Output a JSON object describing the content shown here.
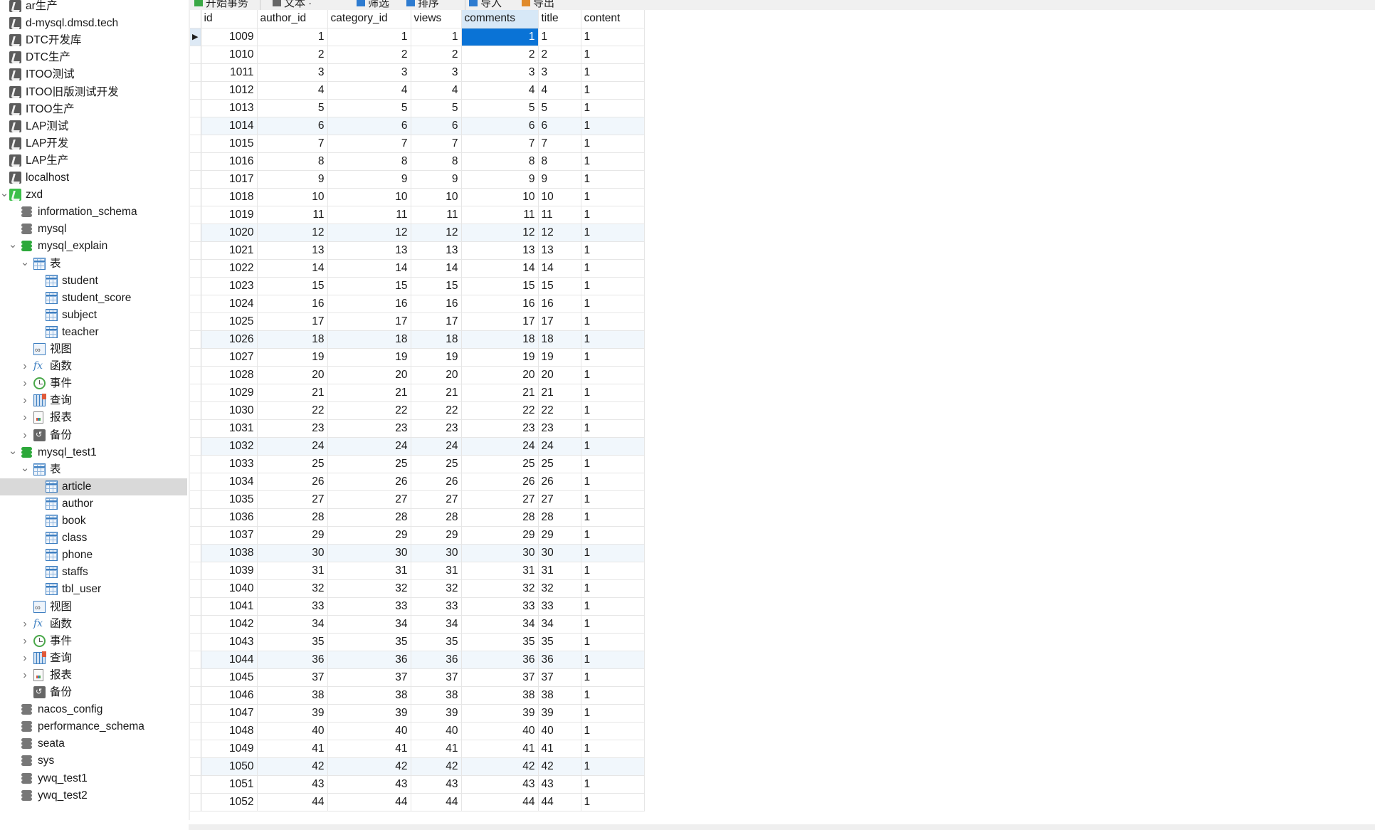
{
  "toolbar": {
    "buttons": [
      {
        "label": "开始事务",
        "icon": "begin-transaction-icon"
      },
      {
        "label": "文本 ·",
        "icon": "text-icon"
      },
      {
        "label": "筛选",
        "icon": "filter-icon"
      },
      {
        "label": "排序",
        "icon": "sort-icon"
      },
      {
        "label": "导入",
        "icon": "import-icon"
      },
      {
        "label": "导出",
        "icon": "export-icon"
      }
    ]
  },
  "sidebar": {
    "items": [
      {
        "label": "ar生产",
        "type": "connection",
        "level": 0
      },
      {
        "label": "d-mysql.dmsd.tech",
        "type": "connection",
        "level": 0
      },
      {
        "label": "DTC开发库",
        "type": "connection",
        "level": 0
      },
      {
        "label": "DTC生产",
        "type": "connection",
        "level": 0
      },
      {
        "label": "ITOO测试",
        "type": "connection",
        "level": 0
      },
      {
        "label": "ITOO旧版测试开发",
        "type": "connection",
        "level": 0
      },
      {
        "label": "ITOO生产",
        "type": "connection",
        "level": 0
      },
      {
        "label": "LAP测试",
        "type": "connection",
        "level": 0
      },
      {
        "label": "LAP开发",
        "type": "connection",
        "level": 0
      },
      {
        "label": "LAP生产",
        "type": "connection",
        "level": 0
      },
      {
        "label": "localhost",
        "type": "connection",
        "level": 0
      },
      {
        "label": "zxd",
        "type": "connection-open",
        "level": 0,
        "expanded": true
      },
      {
        "label": "information_schema",
        "type": "database",
        "level": 1
      },
      {
        "label": "mysql",
        "type": "database",
        "level": 1
      },
      {
        "label": "mysql_explain",
        "type": "database-open",
        "level": 1,
        "expanded": true
      },
      {
        "label": "表",
        "type": "tables",
        "level": 2,
        "expanded": true
      },
      {
        "label": "student",
        "type": "table",
        "level": 3
      },
      {
        "label": "student_score",
        "type": "table",
        "level": 3
      },
      {
        "label": "subject",
        "type": "table",
        "level": 3
      },
      {
        "label": "teacher",
        "type": "table",
        "level": 3
      },
      {
        "label": "视图",
        "type": "views",
        "level": 2
      },
      {
        "label": "函数",
        "type": "functions",
        "level": 2,
        "expanded": false
      },
      {
        "label": "事件",
        "type": "events",
        "level": 2,
        "expanded": false
      },
      {
        "label": "查询",
        "type": "queries",
        "level": 2,
        "expanded": false
      },
      {
        "label": "报表",
        "type": "reports",
        "level": 2,
        "expanded": false
      },
      {
        "label": "备份",
        "type": "backups",
        "level": 2,
        "expanded": false
      },
      {
        "label": "mysql_test1",
        "type": "database-open",
        "level": 1,
        "expanded": true
      },
      {
        "label": "表",
        "type": "tables",
        "level": 2,
        "expanded": true
      },
      {
        "label": "article",
        "type": "table",
        "level": 3,
        "selected": true
      },
      {
        "label": "author",
        "type": "table",
        "level": 3
      },
      {
        "label": "book",
        "type": "table",
        "level": 3
      },
      {
        "label": "class",
        "type": "table",
        "level": 3
      },
      {
        "label": "phone",
        "type": "table",
        "level": 3
      },
      {
        "label": "staffs",
        "type": "table",
        "level": 3
      },
      {
        "label": "tbl_user",
        "type": "table",
        "level": 3
      },
      {
        "label": "视图",
        "type": "views",
        "level": 2
      },
      {
        "label": "函数",
        "type": "functions",
        "level": 2,
        "expanded": false
      },
      {
        "label": "事件",
        "type": "events",
        "level": 2,
        "expanded": false
      },
      {
        "label": "查询",
        "type": "queries",
        "level": 2,
        "expanded": false
      },
      {
        "label": "报表",
        "type": "reports",
        "level": 2,
        "expanded": false
      },
      {
        "label": "备份",
        "type": "backups",
        "level": 2
      },
      {
        "label": "nacos_config",
        "type": "database",
        "level": 1
      },
      {
        "label": "performance_schema",
        "type": "database",
        "level": 1
      },
      {
        "label": "seata",
        "type": "database",
        "level": 1
      },
      {
        "label": "sys",
        "type": "database",
        "level": 1
      },
      {
        "label": "ywq_test1",
        "type": "database",
        "level": 1
      },
      {
        "label": "ywq_test2",
        "type": "database",
        "level": 1
      }
    ]
  },
  "grid": {
    "columns": [
      "id",
      "author_id",
      "category_id",
      "views",
      "comments",
      "title",
      "content"
    ],
    "selected_column": "comments",
    "current_row_index": 0,
    "selected_cell": {
      "row": 0,
      "column": "comments"
    },
    "rows": [
      [
        "1009",
        "1",
        "1",
        "1",
        "1",
        "1",
        "1"
      ],
      [
        "1010",
        "2",
        "2",
        "2",
        "2",
        "2",
        "1"
      ],
      [
        "1011",
        "3",
        "3",
        "3",
        "3",
        "3",
        "1"
      ],
      [
        "1012",
        "4",
        "4",
        "4",
        "4",
        "4",
        "1"
      ],
      [
        "1013",
        "5",
        "5",
        "5",
        "5",
        "5",
        "1"
      ],
      [
        "1014",
        "6",
        "6",
        "6",
        "6",
        "6",
        "1"
      ],
      [
        "1015",
        "7",
        "7",
        "7",
        "7",
        "7",
        "1"
      ],
      [
        "1016",
        "8",
        "8",
        "8",
        "8",
        "8",
        "1"
      ],
      [
        "1017",
        "9",
        "9",
        "9",
        "9",
        "9",
        "1"
      ],
      [
        "1018",
        "10",
        "10",
        "10",
        "10",
        "10",
        "1"
      ],
      [
        "1019",
        "11",
        "11",
        "11",
        "11",
        "11",
        "1"
      ],
      [
        "1020",
        "12",
        "12",
        "12",
        "12",
        "12",
        "1"
      ],
      [
        "1021",
        "13",
        "13",
        "13",
        "13",
        "13",
        "1"
      ],
      [
        "1022",
        "14",
        "14",
        "14",
        "14",
        "14",
        "1"
      ],
      [
        "1023",
        "15",
        "15",
        "15",
        "15",
        "15",
        "1"
      ],
      [
        "1024",
        "16",
        "16",
        "16",
        "16",
        "16",
        "1"
      ],
      [
        "1025",
        "17",
        "17",
        "17",
        "17",
        "17",
        "1"
      ],
      [
        "1026",
        "18",
        "18",
        "18",
        "18",
        "18",
        "1"
      ],
      [
        "1027",
        "19",
        "19",
        "19",
        "19",
        "19",
        "1"
      ],
      [
        "1028",
        "20",
        "20",
        "20",
        "20",
        "20",
        "1"
      ],
      [
        "1029",
        "21",
        "21",
        "21",
        "21",
        "21",
        "1"
      ],
      [
        "1030",
        "22",
        "22",
        "22",
        "22",
        "22",
        "1"
      ],
      [
        "1031",
        "23",
        "23",
        "23",
        "23",
        "23",
        "1"
      ],
      [
        "1032",
        "24",
        "24",
        "24",
        "24",
        "24",
        "1"
      ],
      [
        "1033",
        "25",
        "25",
        "25",
        "25",
        "25",
        "1"
      ],
      [
        "1034",
        "26",
        "26",
        "26",
        "26",
        "26",
        "1"
      ],
      [
        "1035",
        "27",
        "27",
        "27",
        "27",
        "27",
        "1"
      ],
      [
        "1036",
        "28",
        "28",
        "28",
        "28",
        "28",
        "1"
      ],
      [
        "1037",
        "29",
        "29",
        "29",
        "29",
        "29",
        "1"
      ],
      [
        "1038",
        "30",
        "30",
        "30",
        "30",
        "30",
        "1"
      ],
      [
        "1039",
        "31",
        "31",
        "31",
        "31",
        "31",
        "1"
      ],
      [
        "1040",
        "32",
        "32",
        "32",
        "32",
        "32",
        "1"
      ],
      [
        "1041",
        "33",
        "33",
        "33",
        "33",
        "33",
        "1"
      ],
      [
        "1042",
        "34",
        "34",
        "34",
        "34",
        "34",
        "1"
      ],
      [
        "1043",
        "35",
        "35",
        "35",
        "35",
        "35",
        "1"
      ],
      [
        "1044",
        "36",
        "36",
        "36",
        "36",
        "36",
        "1"
      ],
      [
        "1045",
        "37",
        "37",
        "37",
        "37",
        "37",
        "1"
      ],
      [
        "1046",
        "38",
        "38",
        "38",
        "38",
        "38",
        "1"
      ],
      [
        "1047",
        "39",
        "39",
        "39",
        "39",
        "39",
        "1"
      ],
      [
        "1048",
        "40",
        "40",
        "40",
        "40",
        "40",
        "1"
      ],
      [
        "1049",
        "41",
        "41",
        "41",
        "41",
        "41",
        "1"
      ],
      [
        "1050",
        "42",
        "42",
        "42",
        "42",
        "42",
        "1"
      ],
      [
        "1051",
        "43",
        "43",
        "43",
        "43",
        "43",
        "1"
      ],
      [
        "1052",
        "44",
        "44",
        "44",
        "44",
        "44",
        "1"
      ]
    ],
    "highlighted_rows": [
      5,
      11,
      17,
      23,
      29,
      35,
      41
    ],
    "numeric_columns": [
      "id",
      "author_id",
      "category_id",
      "views",
      "comments"
    ],
    "colors": {
      "selected_cell": "#0a73d6",
      "selected_header": "#d7e8f7",
      "highlight_row": "#f1f7fc",
      "sidebar_selected": "#d9d9d9",
      "connection_active": "#3cbf4a",
      "database_active": "#2ca83a"
    }
  }
}
